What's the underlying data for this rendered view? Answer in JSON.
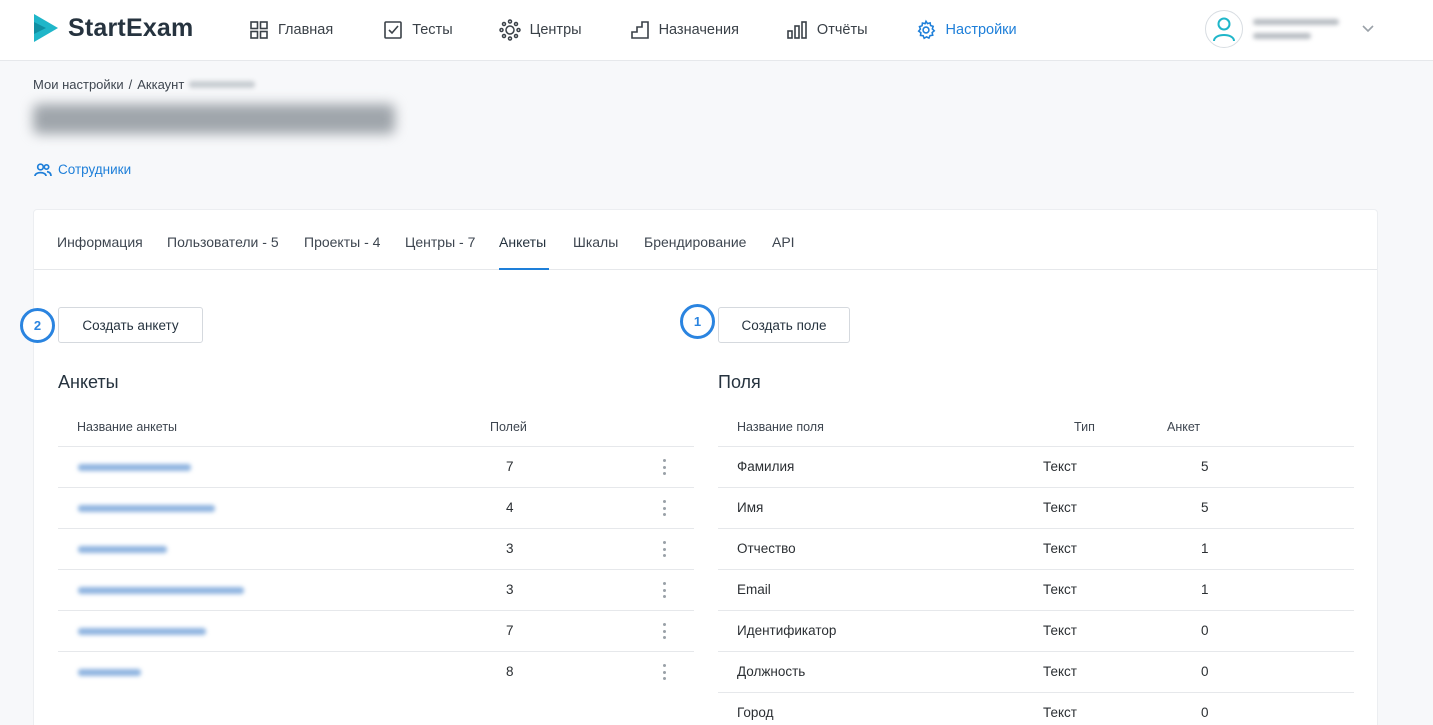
{
  "app": {
    "name": "StartExam"
  },
  "nav": [
    {
      "label": "Главная",
      "icon": "grid-icon"
    },
    {
      "label": "Тесты",
      "icon": "checkbox-icon"
    },
    {
      "label": "Центры",
      "icon": "centers-icon"
    },
    {
      "label": "Назначения",
      "icon": "stairs-icon"
    },
    {
      "label": "Отчёты",
      "icon": "bar-chart-icon"
    },
    {
      "label": "Настройки",
      "icon": "gear-icon"
    }
  ],
  "colors": {
    "accent": "#1e7fd9",
    "callout": "#2a84e0",
    "text": "#2b2f33"
  },
  "breadcrumb": {
    "root": "Мои настройки",
    "separator": "/",
    "current": "Аккаунт"
  },
  "staff_link": {
    "label": "Сотрудники"
  },
  "tabs": [
    {
      "label": "Информация"
    },
    {
      "label": "Пользователи - 5"
    },
    {
      "label": "Проекты - 4"
    },
    {
      "label": "Центры - 7"
    },
    {
      "label": "Анкеты"
    },
    {
      "label": "Шкалы"
    },
    {
      "label": "Брендирование"
    },
    {
      "label": "API"
    }
  ],
  "active_tab": "Анкеты",
  "left": {
    "callout": "2",
    "button": "Создать анкету",
    "title": "Анкеты",
    "headers": {
      "name": "Название анкеты",
      "fields": "Полей"
    },
    "rows": [
      {
        "fields": "7"
      },
      {
        "fields": "4"
      },
      {
        "fields": "3"
      },
      {
        "fields": "3"
      },
      {
        "fields": "7"
      },
      {
        "fields": "8"
      }
    ]
  },
  "right": {
    "callout": "1",
    "button": "Создать поле",
    "title": "Поля",
    "headers": {
      "name": "Название поля",
      "type": "Тип",
      "count": "Анкет"
    },
    "rows": [
      {
        "name": "Фамилия",
        "type": "Текст",
        "count": "5"
      },
      {
        "name": "Имя",
        "type": "Текст",
        "count": "5"
      },
      {
        "name": "Отчество",
        "type": "Текст",
        "count": "1"
      },
      {
        "name": "Email",
        "type": "Текст",
        "count": "1"
      },
      {
        "name": "Идентификатор",
        "type": "Текст",
        "count": "0"
      },
      {
        "name": "Должность",
        "type": "Текст",
        "count": "0"
      },
      {
        "name": "Город",
        "type": "Текст",
        "count": "0"
      }
    ]
  }
}
